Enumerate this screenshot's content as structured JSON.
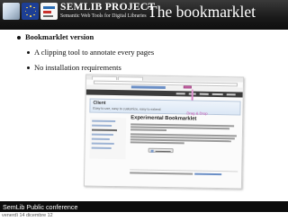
{
  "header": {
    "brand_title": "SEMLIB PROJECT",
    "brand_subtitle": "Semantic Web Tools for Digital Libraries",
    "slide_title": "The bookmarklet"
  },
  "bullets": {
    "main": "Bookmarklet version",
    "sub1": "A clipping tool to annotate every pages",
    "sub2": "No installation requirements"
  },
  "screenshot": {
    "client_title": "Client",
    "client_subtitle": "Easy to use, easy to customize, easy to extend.",
    "drag_drop": "Drag & Drop",
    "experimental_title": "Experimental Bookmarklet"
  },
  "footer": {
    "conference": "SemLib Public conference",
    "date": "venerdì 14 dicembre 12"
  },
  "colors": {
    "header_bg": "#1a1a1a",
    "accent_pink": "#c84fb0",
    "link_blue": "#6b8fc6"
  }
}
